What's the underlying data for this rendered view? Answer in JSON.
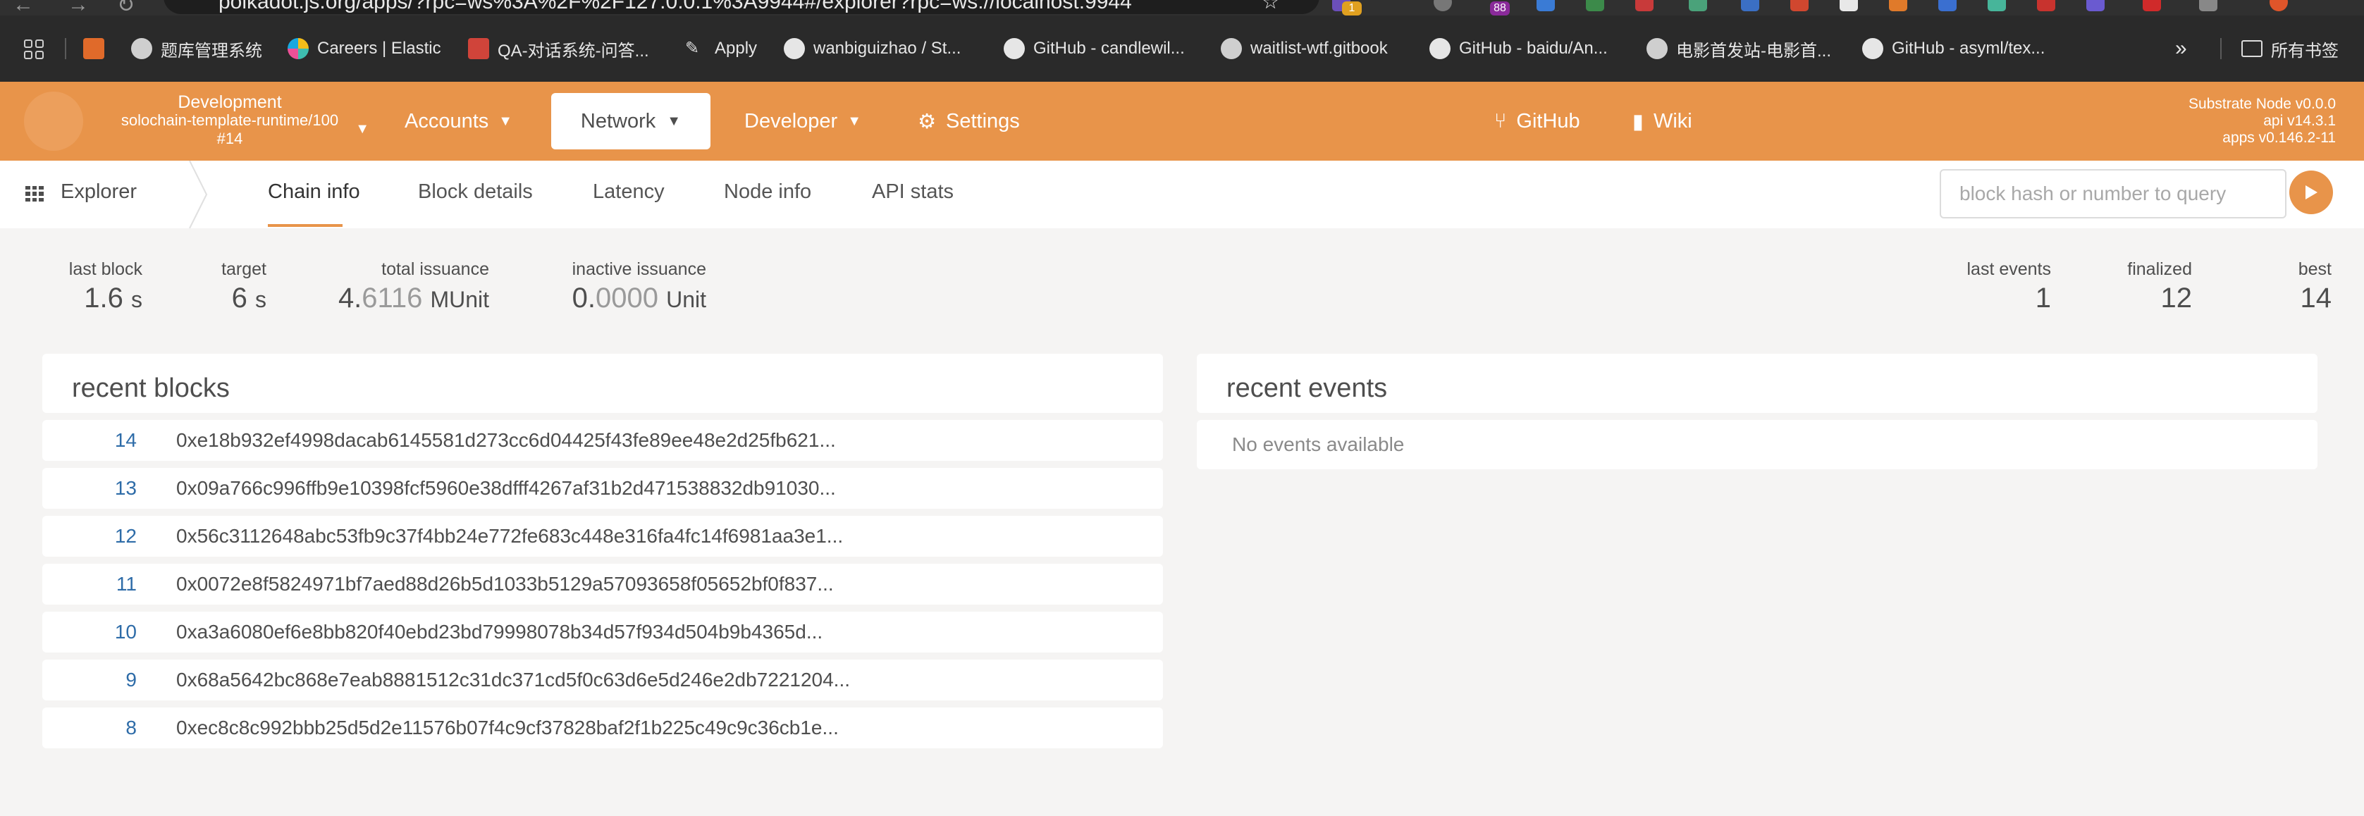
{
  "browser": {
    "url": "polkadot.js.org/apps/?rpc=ws%3A%2F%2F127.0.0.1%3A9944#/explorer?rpc=ws://localhost:9944",
    "ext_badges": [
      "1",
      "88"
    ],
    "bookmarks": [
      {
        "label": "题库管理系统",
        "icon": "globe-icon"
      },
      {
        "label": "Careers | Elastic",
        "icon": "elastic-icon"
      },
      {
        "label": "QA-对话系统-问答...",
        "icon": "red-tile-icon"
      },
      {
        "label": "Apply",
        "icon": "pen-icon"
      },
      {
        "label": "wanbiguizhao / St...",
        "icon": "github-icon"
      },
      {
        "label": "GitHub - candlewil...",
        "icon": "github-icon"
      },
      {
        "label": "waitlist-wtf.gitbook",
        "icon": "globe-icon"
      },
      {
        "label": "GitHub - baidu/An...",
        "icon": "github-icon"
      },
      {
        "label": "电影首发站-电影首...",
        "icon": "globe-icon"
      },
      {
        "label": "GitHub - asyml/tex...",
        "icon": "github-icon"
      }
    ],
    "all_bookmarks": "所有书签"
  },
  "header": {
    "chain": {
      "mode": "Development",
      "runtime": "solochain-template-runtime/100",
      "block": "#14"
    },
    "menu": {
      "accounts": "Accounts",
      "network": "Network",
      "developer": "Developer",
      "settings": "Settings",
      "github": "GitHub",
      "wiki": "Wiki"
    },
    "version": {
      "node": "Substrate Node v0.0.0",
      "api": "api v14.3.1",
      "apps": "apps v0.146.2-11"
    }
  },
  "subnav": {
    "section": "Explorer",
    "tabs": [
      "Chain info",
      "Block details",
      "Latency",
      "Node info",
      "API stats"
    ],
    "active_tab": "Chain info",
    "query_placeholder": "block hash or number to query"
  },
  "summary": {
    "last_block": {
      "label": "last block",
      "value": "1.6",
      "unit": "s"
    },
    "target": {
      "label": "target",
      "value": "6",
      "unit": "s"
    },
    "total_issuance": {
      "label": "total issuance",
      "int": "4.",
      "frac": "6116",
      "unit": "MUnit"
    },
    "inactive_issuance": {
      "label": "inactive issuance",
      "int": "0.",
      "frac": "0000",
      "unit": "Unit"
    },
    "last_events": {
      "label": "last events",
      "value": "1"
    },
    "finalized": {
      "label": "finalized",
      "value": "12"
    },
    "best": {
      "label": "best",
      "value": "14"
    }
  },
  "recent_blocks": {
    "title": "recent blocks",
    "rows": [
      {
        "number": "14",
        "hash": "0xe18b932ef4998dacab6145581d273cc6d04425f43fe89ee48e2d25fb621..."
      },
      {
        "number": "13",
        "hash": "0x09a766c996ffb9e10398fcf5960e38dfff4267af31b2d471538832db91030..."
      },
      {
        "number": "12",
        "hash": "0x56c3112648abc53fb9c37f4bb24e772fe683c448e316fa4fc14f6981aa3e1..."
      },
      {
        "number": "11",
        "hash": "0x0072e8f5824971bf7aed88d26b5d1033b5129a57093658f05652bf0f837..."
      },
      {
        "number": "10",
        "hash": "0xa3a6080ef6e8bb820f40ebd23bd79998078b34d57f934d504b9b4365d..."
      },
      {
        "number": "9",
        "hash": "0x68a5642bc868e7eab8881512c31dc371cd5f0c63d6e5d246e2db7221204..."
      },
      {
        "number": "8",
        "hash": "0xec8c8c992bbb25d5d2e11576b07f4c9cf37828baf2f1b225c49c9c36cb1e..."
      }
    ]
  },
  "recent_events": {
    "title": "recent events",
    "empty_text": "No events available"
  },
  "colors": {
    "accent": "#e8944a",
    "link": "#2e6ca8",
    "background": "#f5f4f3"
  }
}
